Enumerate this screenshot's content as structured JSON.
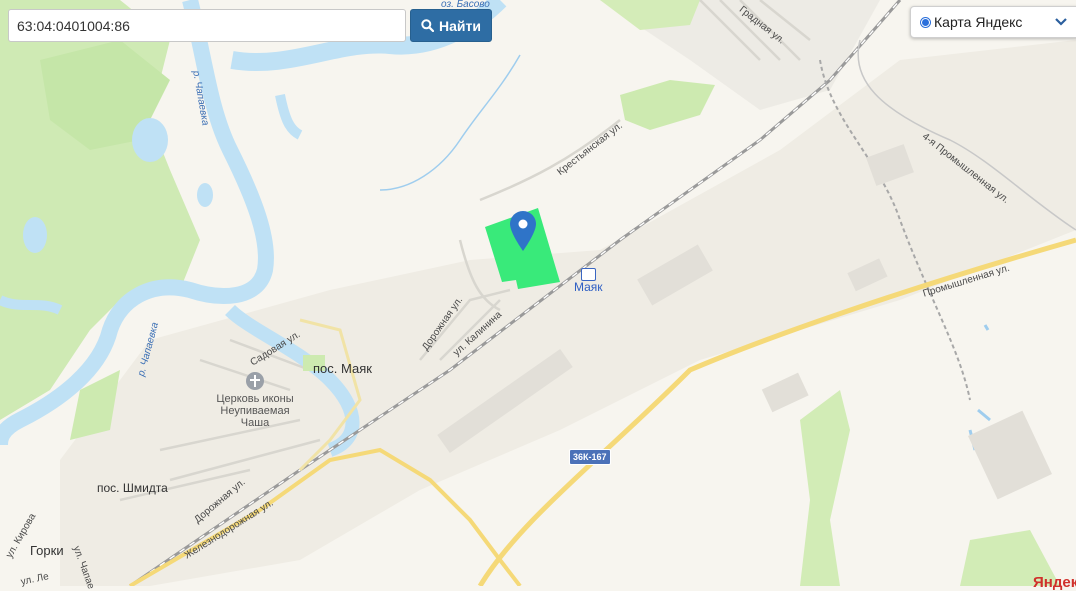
{
  "search": {
    "value": "63:04:0401004:86",
    "button_label": "Найти"
  },
  "layer_switcher": {
    "selected_label": "Карта Яндекс"
  },
  "map": {
    "labels": {
      "lake": "оз. Басово",
      "river_upper": "р. Чапаевка",
      "river_lower": "р. Чапаевка",
      "street_grad": "Градная ул.",
      "street_krest": "Крестьянская ул.",
      "street_prom4": "4-я Промышленная ул.",
      "street_prom": "Промышленная ул.",
      "street_sad": "Садовая ул.",
      "street_dor_1": "Дорожная ул.",
      "street_kal": "ул. Калинина",
      "street_dor_2": "Дорожная ул.",
      "street_zhel": "Железнодорожная ул.",
      "street_kirova": "ул. Кирова",
      "street_chapae": "ул. Чапае",
      "street_le": "ул. Ле",
      "settlement_mayak": "пос. Маяк",
      "settlement_shmidta": "пос. Шмидта",
      "settlement_gorki": "Горки",
      "church": "Церковь иконы Неупиваемая Чаша",
      "station": "Маяк",
      "road_shield": "36К-167",
      "corner_partial": "Яндек"
    },
    "colors": {
      "background": "#f7f5ef",
      "water": "#bfe1f5",
      "forest": "#cfeab4",
      "parcel": "#39ea7a",
      "marker": "#2f74c8",
      "main_road": "#f5d978",
      "search_button": "#2e6da4"
    },
    "icons": [
      "search-icon",
      "chevron-down-icon",
      "map-marker-icon",
      "railway-station-icon",
      "church-icon"
    ]
  }
}
